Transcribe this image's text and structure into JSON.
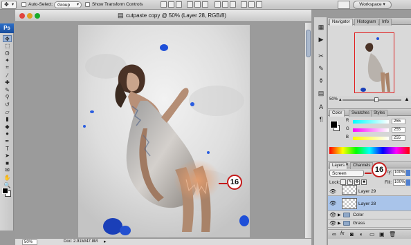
{
  "options_bar": {
    "auto_select_label": "Auto-Select:",
    "auto_select_value": "Group",
    "show_transform_label": "Show Transform Controls",
    "workspace_label": "Workspace"
  },
  "toolbox": {
    "logo": "Ps",
    "tools": [
      "move-icon",
      "marquee-icon",
      "lasso-icon",
      "magic-wand-icon",
      "crop-icon",
      "eyedropper-icon",
      "healing-icon",
      "brush-icon",
      "stamp-icon",
      "history-brush-icon",
      "eraser-icon",
      "gradient-icon",
      "blur-icon",
      "dodge-icon",
      "pen-icon",
      "type-icon",
      "path-select-icon",
      "shape-icon",
      "notes-icon",
      "hand-icon",
      "zoom-icon"
    ],
    "foreground_color": "#000000",
    "background_color": "#ffffff"
  },
  "document": {
    "title": "cutpaste copy @ 50% (Layer 28, RGB/8)",
    "zoom": "50%",
    "doc_info": "Doc: 2.91M/47.8M"
  },
  "navigator": {
    "tabs": [
      "Navigator",
      "Histogram",
      "Info"
    ],
    "zoom": "50%",
    "view_rect_color": "#e01c1c"
  },
  "color_panel": {
    "tabs": [
      "Color",
      "Swatches",
      "Styles"
    ],
    "channels": [
      {
        "label": "R",
        "value": "255"
      },
      {
        "label": "G",
        "value": "255"
      },
      {
        "label": "B",
        "value": "255"
      }
    ]
  },
  "layers_panel": {
    "tabs": [
      "Layers",
      "Channels"
    ],
    "blend_mode": "Screen",
    "opacity_label": "ty:",
    "opacity_value": "100%",
    "lock_label": "Lock:",
    "fill_label": "Fill:",
    "fill_value": "100%",
    "layers": [
      {
        "name": "Layer 29",
        "selected": false,
        "kind": "layer"
      },
      {
        "name": "Layer 28",
        "selected": true,
        "kind": "layer"
      },
      {
        "name": "Color",
        "selected": false,
        "kind": "group"
      },
      {
        "name": "Grass",
        "selected": false,
        "kind": "group"
      }
    ]
  },
  "callouts": [
    {
      "label": "16"
    },
    {
      "label": "16"
    }
  ]
}
